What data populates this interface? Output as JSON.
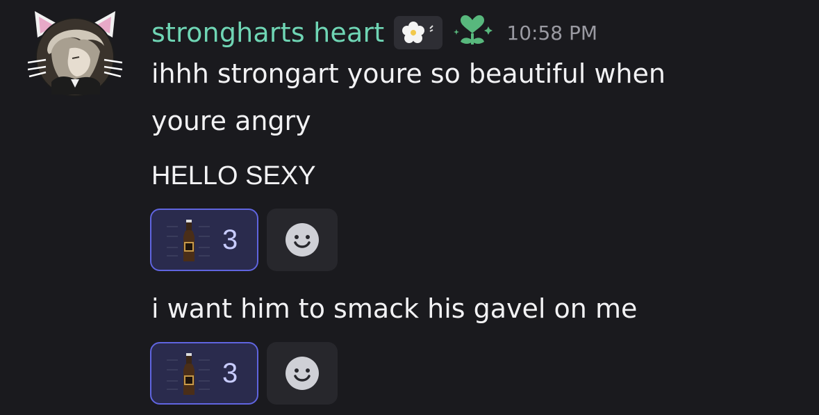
{
  "message": {
    "author": "strongharts heart",
    "timestamp": "10:58 PM",
    "icons": {
      "avatar": "cat-ear-avatar",
      "tag": "flower-tag-icon",
      "badge": "green-heart-sparkle-icon"
    },
    "lines": [
      "ihhh strongart youre so beautiful when",
      "youre angry",
      "HELLO SEXY",
      "i want him to smack his gavel on me"
    ],
    "reactions": [
      {
        "emoji": "beer-bottle-icon",
        "count": "3"
      },
      {
        "emoji": "beer-bottle-icon",
        "count": "3"
      }
    ],
    "add_reaction_icon": "smiley-face-icon"
  },
  "colors": {
    "background": "#1a1a1e",
    "username": "#6fd5b4",
    "reaction_border": "#6065e0",
    "reaction_bg": "#2a2b4d"
  }
}
